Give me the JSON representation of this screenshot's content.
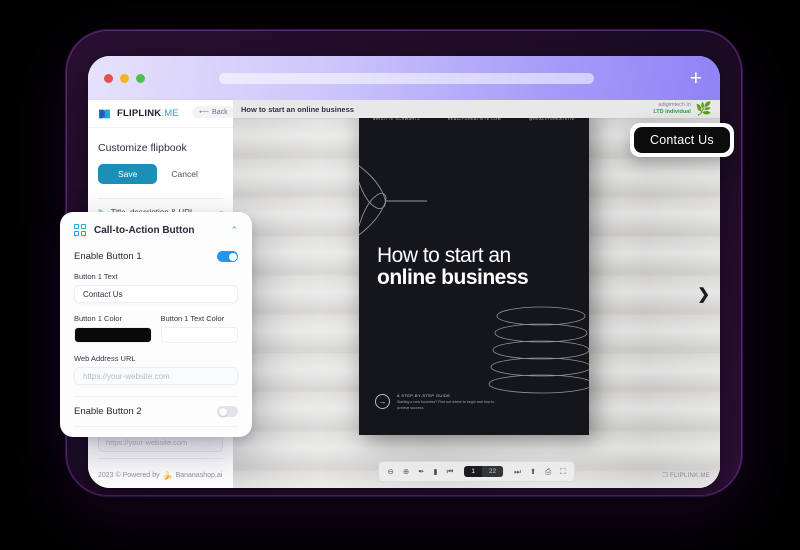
{
  "browser": {
    "traffic_lights": [
      "close",
      "minimize",
      "maximize"
    ],
    "url_value": "",
    "new_tab_label": "+"
  },
  "sidebar": {
    "brand_name": "FLIPLINK",
    "brand_suffix": ".ME",
    "back_label": "Back",
    "panel_title": "Customize flipbook",
    "save_label": "Save",
    "cancel_label": "Cancel",
    "accordion": {
      "label": "Title, description & URL",
      "chevron": "chevron-down-icon"
    },
    "ghost_url_value": "https://your-website.com",
    "footer_text": "2023 © Powered by",
    "footer_brand": "Bananashop.ai"
  },
  "viewer": {
    "doc_title": "How to start an online business",
    "account": {
      "line1": "adigimtech.in",
      "line2": "LTD individual"
    },
    "next_arrow": "❯",
    "watermark": "FLIPLINK.ME",
    "toolbar": {
      "icons": [
        "zoom-out-icon",
        "zoom-in-icon",
        "pen-icon",
        "bookmark-icon",
        "first-page-icon"
      ],
      "icons_right": [
        "last-page-icon",
        "upload-icon",
        "print-icon",
        "fullscreen-icon"
      ],
      "current_page": "1",
      "total_pages": "22"
    }
  },
  "book_cover": {
    "author": "BRIGITTE SCHWARTZ",
    "website": "REALLYGREATSITE.COM",
    "handle": "@REALLYGREATSITE",
    "title_line1": "How to start an",
    "title_line2": "online business",
    "cta_kicker": "A STEP-BY-STEP GUIDE",
    "cta_body": "Starting a new business? Find out where to begin and how to achieve success.",
    "arrow": "→",
    "bg_color": "#15161c"
  },
  "contact_float": {
    "label": "Contact Us",
    "bg_color": "#0c0c0d",
    "text_color": "#ffffff"
  },
  "cta_panel": {
    "title": "Call-to-Action Button",
    "collapse_icon": "chevron-up-icon",
    "enable_button_1_label": "Enable Button 1",
    "enable_button_1_state": "on",
    "button_1_text_label": "Button 1 Text",
    "button_1_text_value": "Contact Us",
    "button_1_color_label": "Button 1 Color",
    "button_1_color_value": "#0a0a0a",
    "button_1_text_color_label": "Button 1 Text Color",
    "button_1_text_color_value": "#ffffff",
    "web_address_label": "Web Address URL",
    "web_address_placeholder": "https://your-website.com",
    "enable_button_2_label": "Enable Button 2",
    "enable_button_2_state": "off"
  },
  "colors": {
    "accent_blue": "#2aa3da",
    "save_teal": "#1b8fb5",
    "toggle_on": "#2196f3",
    "frame_purple": "#2a1033"
  }
}
